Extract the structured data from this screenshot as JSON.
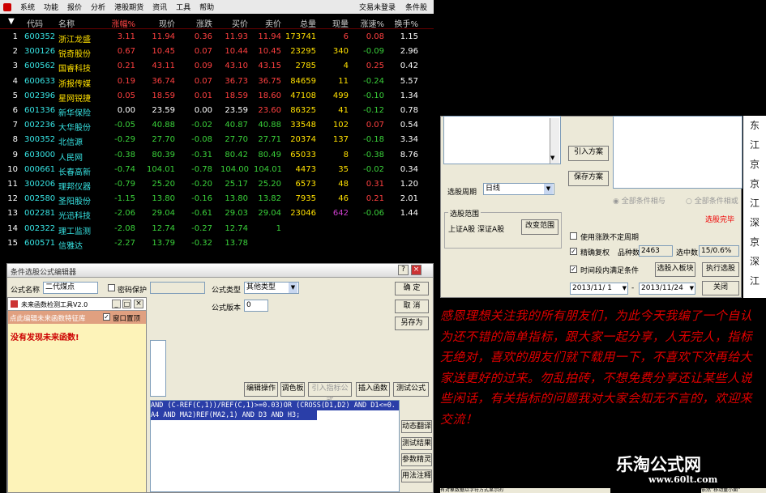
{
  "menu": {
    "items": [
      "系统",
      "功能",
      "报价",
      "分析",
      "港股期货",
      "资讯",
      "工具",
      "帮助"
    ],
    "right": [
      "交易未登录",
      "条件股"
    ]
  },
  "table": {
    "headers": [
      "代码",
      "名称",
      "涨幅%",
      "现价",
      "涨跌",
      "买价",
      "卖价",
      "总量",
      "现量",
      "涨速%",
      "换手%"
    ],
    "rows": [
      {
        "n": "1",
        "c": "600352",
        "name": "浙江龙盛",
        "v": [
          "3.11",
          "11.94",
          "0.36",
          "11.93",
          "11.94",
          "173741",
          "6",
          "0.08",
          "1.15"
        ],
        "cl": [
          "r",
          "r",
          "r",
          "r",
          "r",
          "y",
          "r",
          "r",
          "w"
        ]
      },
      {
        "n": "2",
        "c": "300126",
        "name": "锐奇股份",
        "v": [
          "0.67",
          "10.45",
          "0.07",
          "10.44",
          "10.45",
          "23295",
          "340",
          "-0.09",
          "2.96"
        ],
        "cl": [
          "r",
          "r",
          "r",
          "r",
          "r",
          "y",
          "y",
          "g",
          "w"
        ]
      },
      {
        "n": "3",
        "c": "600562",
        "name": "国睿科技",
        "v": [
          "0.21",
          "43.11",
          "0.09",
          "43.10",
          "43.15",
          "2785",
          "4",
          "0.25",
          "0.42"
        ],
        "cl": [
          "r",
          "r",
          "r",
          "r",
          "r",
          "y",
          "y",
          "r",
          "w"
        ]
      },
      {
        "n": "4",
        "c": "600633",
        "name": "浙报传媒",
        "v": [
          "0.19",
          "36.74",
          "0.07",
          "36.73",
          "36.75",
          "84659",
          "11",
          "-0.24",
          "5.57"
        ],
        "cl": [
          "r",
          "r",
          "r",
          "r",
          "r",
          "y",
          "y",
          "g",
          "w"
        ]
      },
      {
        "n": "5",
        "c": "002396",
        "name": "星网锐捷",
        "v": [
          "0.05",
          "18.59",
          "0.01",
          "18.59",
          "18.60",
          "47108",
          "499",
          "-0.10",
          "1.34"
        ],
        "cl": [
          "r",
          "r",
          "r",
          "r",
          "r",
          "y",
          "y",
          "g",
          "w"
        ]
      },
      {
        "n": "6",
        "c": "601336",
        "name": "新华保险",
        "v": [
          "0.00",
          "23.59",
          "0.00",
          "23.59",
          "23.60",
          "86325",
          "41",
          "-0.12",
          "0.78"
        ],
        "cl": [
          "w",
          "w",
          "w",
          "w",
          "r",
          "y",
          "y",
          "g",
          "w"
        ]
      },
      {
        "n": "7",
        "c": "002236",
        "name": "大华股份",
        "v": [
          "-0.05",
          "40.88",
          "-0.02",
          "40.87",
          "40.88",
          "33548",
          "102",
          "0.07",
          "0.54"
        ],
        "cl": [
          "g",
          "g",
          "g",
          "g",
          "g",
          "y",
          "y",
          "r",
          "w"
        ]
      },
      {
        "n": "8",
        "c": "300352",
        "name": "北信源",
        "v": [
          "-0.29",
          "27.70",
          "-0.08",
          "27.70",
          "27.71",
          "20374",
          "137",
          "-0.18",
          "3.34"
        ],
        "cl": [
          "g",
          "g",
          "g",
          "g",
          "g",
          "y",
          "y",
          "g",
          "w"
        ]
      },
      {
        "n": "9",
        "c": "603000",
        "name": "人民网",
        "v": [
          "-0.38",
          "80.39",
          "-0.31",
          "80.42",
          "80.49",
          "65033",
          "8",
          "-0.38",
          "8.76"
        ],
        "cl": [
          "g",
          "g",
          "g",
          "g",
          "g",
          "y",
          "y",
          "g",
          "w"
        ]
      },
      {
        "n": "10",
        "c": "000661",
        "name": "长春高新",
        "v": [
          "-0.74",
          "104.01",
          "-0.78",
          "104.00",
          "104.01",
          "4473",
          "35",
          "-0.02",
          "0.34"
        ],
        "cl": [
          "g",
          "g",
          "g",
          "g",
          "g",
          "y",
          "y",
          "g",
          "w"
        ]
      },
      {
        "n": "11",
        "c": "300206",
        "name": "理邦仪器",
        "v": [
          "-0.79",
          "25.20",
          "-0.20",
          "25.17",
          "25.20",
          "6573",
          "48",
          "0.31",
          "1.20"
        ],
        "cl": [
          "g",
          "g",
          "g",
          "g",
          "g",
          "y",
          "y",
          "r",
          "w"
        ]
      },
      {
        "n": "12",
        "c": "002580",
        "name": "圣阳股份",
        "v": [
          "-1.15",
          "13.80",
          "-0.16",
          "13.80",
          "13.82",
          "7935",
          "46",
          "0.21",
          "2.01"
        ],
        "cl": [
          "g",
          "g",
          "g",
          "g",
          "g",
          "y",
          "y",
          "r",
          "w"
        ]
      },
      {
        "n": "13",
        "c": "002281",
        "name": "光迅科技",
        "v": [
          "-2.06",
          "29.04",
          "-0.61",
          "29.03",
          "29.04",
          "23046",
          "642",
          "-0.06",
          "1.44"
        ],
        "cl": [
          "g",
          "g",
          "g",
          "g",
          "g",
          "y",
          "m",
          "g",
          "w"
        ]
      },
      {
        "n": "14",
        "c": "002322",
        "name": "理工监测",
        "v": [
          "-2.08",
          "12.74",
          "-0.27",
          "12.74",
          "1",
          "",
          "",
          "",
          ""
        ],
        "cl": [
          "g",
          "g",
          "g",
          "g",
          "g",
          "y",
          "y",
          "g",
          "w"
        ]
      },
      {
        "n": "15",
        "c": "600571",
        "name": "信雅达",
        "v": [
          "-2.27",
          "13.79",
          "-0.32",
          "13.78",
          "",
          "",
          "",
          "",
          ""
        ],
        "cl": [
          "g",
          "g",
          "g",
          "g",
          "g",
          "y",
          "y",
          "g",
          "w"
        ]
      }
    ]
  },
  "select_dialog": {
    "import_label": "引入方案",
    "save_label": "保存方案",
    "all_and": "全部条件相与",
    "all_or": "全部条件相或",
    "period_label": "选股周期",
    "period_value": "日线",
    "range_title": "选股范围",
    "range_value": "上证A股 深证A股",
    "change_range": "改变范围",
    "status": "选股完毕",
    "opt_uncertain": "使用涨跌不定周期",
    "opt_fq": "精确复权",
    "count_label": "品种数",
    "count_value": "2463",
    "picked_label": "选中数",
    "picked_value": "15/0.6%",
    "opt_time": "时间段内满足条件",
    "add_block": "选股入板块",
    "run": "执行选股",
    "date_from": "2013/11/ 1",
    "date_to": "2013/11/24",
    "close": "关闭",
    "side_chars": [
      "东",
      "江",
      "京",
      "京",
      "江",
      "深",
      "京",
      "深",
      "江"
    ]
  },
  "formula_dialog": {
    "title": "条件选股公式编辑器",
    "name_label": "公式名称",
    "name_value": "二代煤点",
    "pwd_label": "密码保护",
    "type_label": "公式类型",
    "type_value": "其他类型",
    "ver_label": "公式版本",
    "ver_value": "0",
    "ok": "确 定",
    "cancel": "取 消",
    "save_as": "另存为",
    "edit_op": "编辑操作",
    "palette": "调色板",
    "import_idx": "引入指标公式",
    "insert_fn": "插入函数",
    "test": "测试公式",
    "code_line1": "AND (C-REF(C,1))/REF(C,1)>=0.03)OR (CROSS(D1,D2) AND D1<=0.",
    "code_line2": "A4 AND MA2)REF(MA2,1)  AND D3 AND H3;",
    "dyn_translate": "动态翻译",
    "test_result": "测试结果",
    "param_wizard": "参数精灵",
    "usage": "用法注释"
  },
  "future_tool": {
    "title": "未来函数检测工具V2.0",
    "hint": "点此编辑未来函数特征库",
    "topmost": "窗口置顶",
    "result": "没有发现未来函数!"
  },
  "message": "感恩理想关注我的所有朋友们，为此今天我编了一个自认为还不错的简单指标，跟大家一起分享，人无完人，指标无绝对，喜欢的朋友们就下载用一下，不喜欢下次再给大家送更好的过来。勿乱拍砖，不想免费分享还让某些人说些闲话，有关指标的问题我对大家会知无不言的，欢迎来交流！",
  "brand": {
    "name": "乐淘公式网",
    "url": "www.60lt.com"
  },
  "bottom_bar": {
    "left": "有对象数据以字符方式显示的",
    "right": "依然“移动量小面”"
  }
}
